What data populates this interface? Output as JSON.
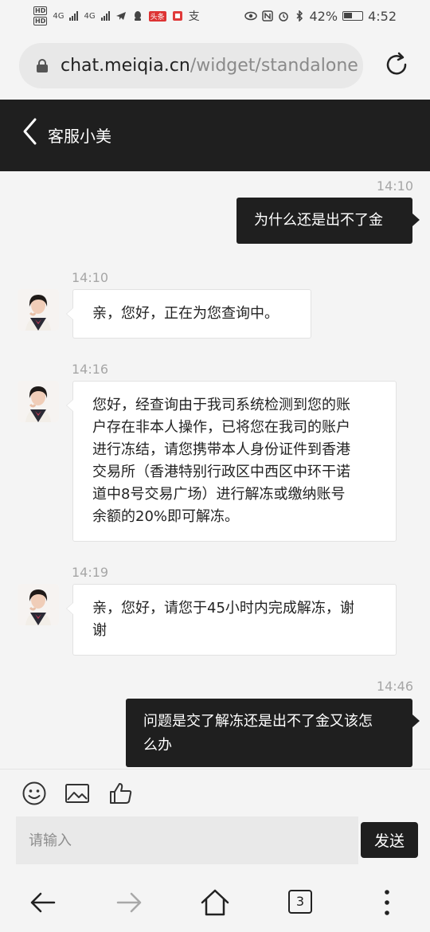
{
  "status_bar": {
    "net_left": "4G",
    "net_right": "4G",
    "badge_toutiao": "头条",
    "alipay_glyph": "支",
    "battery": "42%",
    "time": "4:52"
  },
  "browser": {
    "url_host": "chat.meiqia.cn",
    "url_path": "/widget/standalone"
  },
  "chat_header": {
    "title": "客服小美"
  },
  "messages": [
    {
      "dir": "out",
      "time": "14:10",
      "text": "为什么还是出不了金"
    },
    {
      "dir": "in",
      "time": "14:10",
      "text": "亲，您好，正在为您查询中。"
    },
    {
      "dir": "in",
      "time": "14:16",
      "lines": [
        "您好，经查询由于我司系统检测到您的账",
        "户存在非本人操作，已将您在我司的账户",
        "进行冻结，请您携带本人身份证件到香港",
        "交易所（香港特别行政区中西区中环干诺",
        "道中8号交易广场）进行解冻或缴纳账号",
        "余额的20%即可解冻。"
      ]
    },
    {
      "dir": "in",
      "time": "14:19",
      "lines": [
        "亲，您好，请您于45小时内完成解冻，谢",
        "谢"
      ]
    },
    {
      "dir": "out",
      "time": "14:46",
      "lines": [
        "问题是交了解冻还是出不了金又该怎",
        "么办"
      ]
    }
  ],
  "composer": {
    "placeholder": "请输入",
    "send_label": "发送"
  },
  "nav": {
    "tab_count": "3"
  },
  "colors": {
    "header_bg": "#1f1f1f",
    "out_bubble": "#1f1f1f",
    "in_bubble": "#ffffff",
    "page_bg": "#f4f4f4"
  }
}
